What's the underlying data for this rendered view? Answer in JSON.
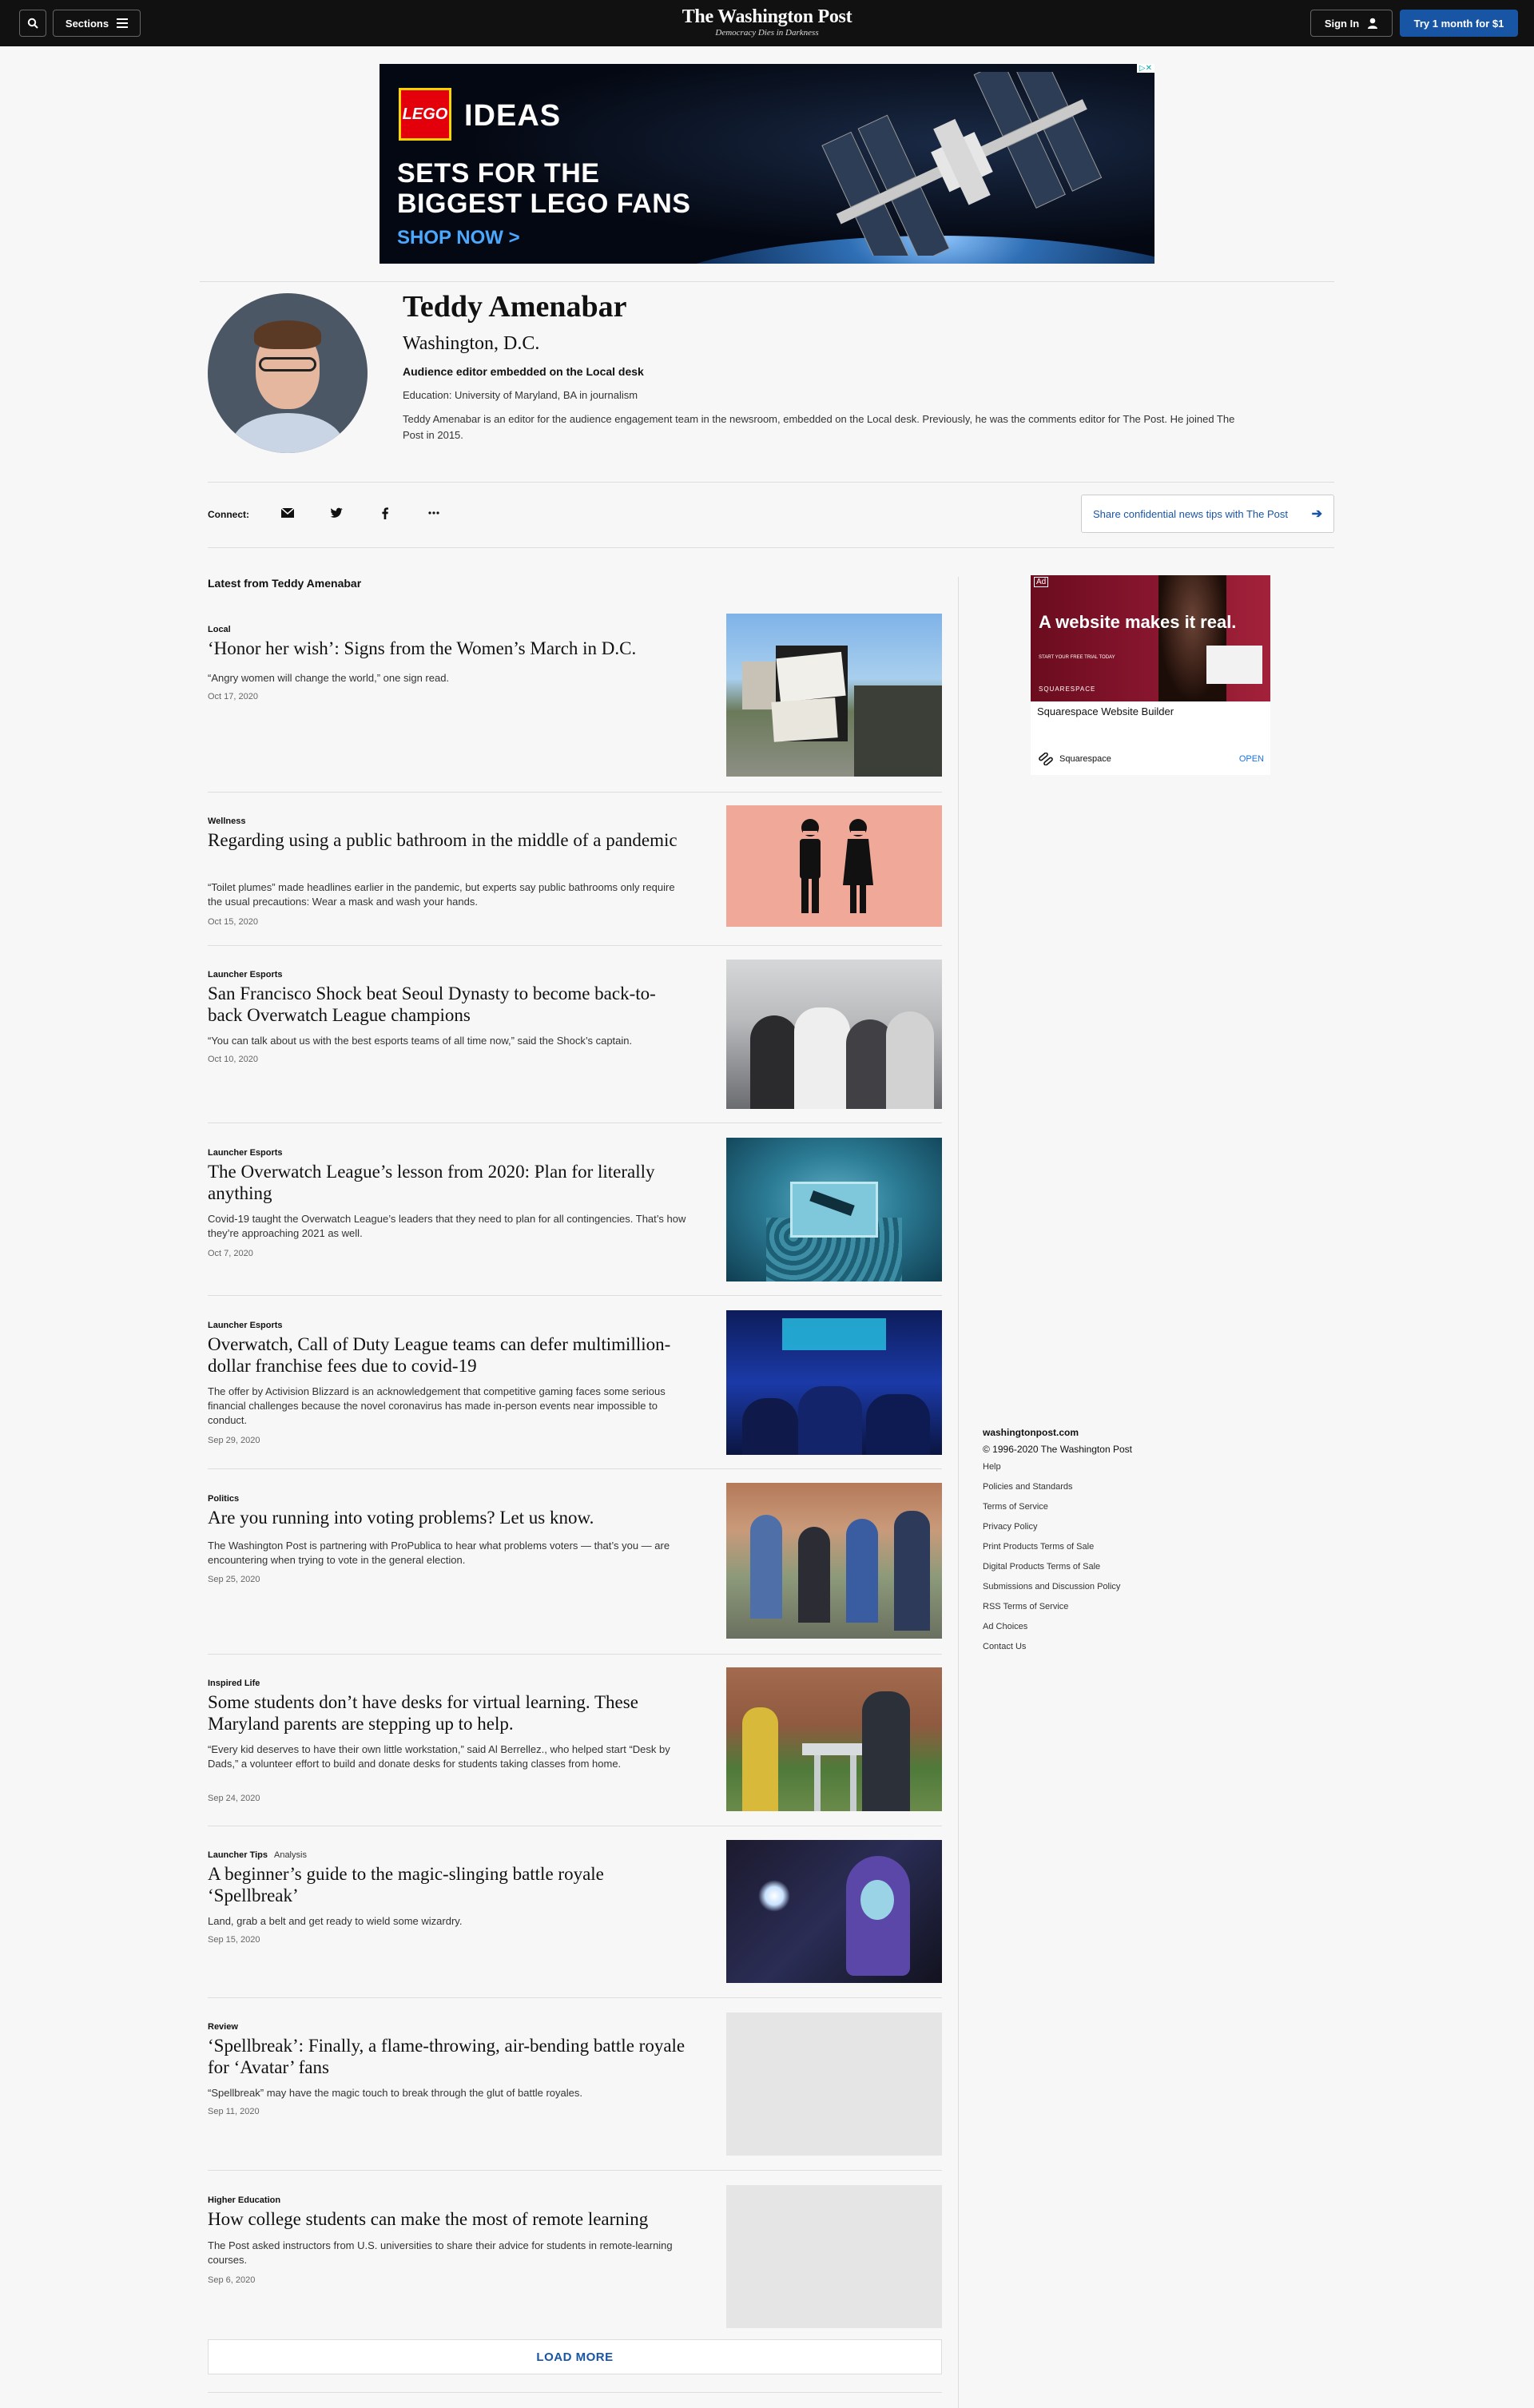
{
  "topbar": {
    "sections_label": "Sections",
    "logo_name": "The Washington Post",
    "logo_tagline": "Democracy Dies in Darkness",
    "signin_label": "Sign In",
    "trial_label": "Try 1 month for $1"
  },
  "top_ad": {
    "brand": "LEGO",
    "product": "IDEAS",
    "line1": "SETS FOR THE",
    "line2": "BIGGEST LEGO FANS",
    "cta": "SHOP NOW >"
  },
  "profile": {
    "name": "Teddy Amenabar",
    "location": "Washington, D.C.",
    "role": "Audience editor embedded on the Local desk",
    "education": "Education: University of Maryland, BA in journalism",
    "bio": "Teddy Amenabar is an editor for the audience engagement team in the newsroom, embedded on the Local desk. Previously, he was the comments editor for The Post. He joined The Post in 2015."
  },
  "connect": {
    "label": "Connect:",
    "share_label": "Share confidential news tips with The Post"
  },
  "latest_label": "Latest from Teddy Amenabar",
  "articles": [
    {
      "kicker": "Local",
      "headline": "‘Honor her wish’: Signs from the Women’s March in D.C.",
      "blurb": "“Angry women will change the world,” one sign read.",
      "date": "Oct 17, 2020"
    },
    {
      "kicker": "Wellness",
      "headline": "Regarding using a public bathroom in the middle of a pandemic",
      "blurb": "“Toilet plumes” made headlines earlier in the pandemic, but experts say public bathrooms only require the usual precautions: Wear a mask and wash your hands.",
      "date": "Oct 15, 2020"
    },
    {
      "kicker": "Launcher Esports",
      "headline": "San Francisco Shock beat Seoul Dynasty to become back-to-back Overwatch League champions",
      "blurb": "“You can talk about us with the best esports teams of all time now,” said the Shock’s captain.",
      "date": "Oct 10, 2020"
    },
    {
      "kicker": "Launcher Esports",
      "headline": "The Overwatch League’s lesson from 2020: Plan for literally anything",
      "blurb": "Covid-19 taught the Overwatch League’s leaders that they need to plan for all contingencies. That’s how they’re approaching 2021 as well.",
      "date": "Oct 7, 2020"
    },
    {
      "kicker": "Launcher Esports",
      "headline": "Overwatch, Call of Duty League teams can defer multimillion-dollar franchise fees due to covid-19",
      "blurb": "The offer by Activision Blizzard is an acknowledgement that competitive gaming faces some serious financial challenges because the novel coronavirus has made in-person events near impossible to conduct.",
      "date": "Sep 29, 2020"
    },
    {
      "kicker": "Politics",
      "headline": "Are you running into voting problems? Let us know.",
      "blurb": "The Washington Post is partnering with ProPublica to hear what problems voters — that’s you — are encountering when trying to vote in the general election.",
      "date": "Sep 25, 2020"
    },
    {
      "kicker": "Inspired Life",
      "headline": "Some students don’t have desks for virtual learning. These Maryland parents are stepping up to help.",
      "blurb": "“Every kid deserves to have their own little workstation,” said Al Berrellez., who helped start “Desk by Dads,” a volunteer effort to build and donate desks for students taking classes from home.",
      "date": "Sep 24, 2020"
    },
    {
      "kicker": "Launcher Tips",
      "kicker_sub": "Analysis",
      "headline": "A beginner’s guide to the magic-slinging battle royale ‘Spellbreak’",
      "blurb": "Land, grab a belt and get ready to wield some wizardry.",
      "date": "Sep 15, 2020"
    },
    {
      "kicker": "Review",
      "headline": "‘Spellbreak’: Finally, a flame-throwing, air-bending battle royale for ‘Avatar’ fans",
      "blurb": "“Spellbreak” may have the magic touch to break through the glut of battle royales.",
      "date": "Sep 11, 2020"
    },
    {
      "kicker": "Higher Education",
      "headline": "How college students can make the most of remote learning",
      "blurb": "The Post asked instructors from U.S. universities to share their advice for students in remote-learning courses.",
      "date": "Sep 6, 2020"
    }
  ],
  "load_more": "LOAD MORE",
  "side_ad": {
    "tag": "Ad",
    "headline": "A website makes it real.",
    "sub": "START YOUR FREE TRIAL TODAY",
    "brand_small": "SQUARESPACE",
    "title": "Squarespace Website Builder",
    "brand": "Squarespace",
    "open": "OPEN"
  },
  "footer": {
    "site": "washingtonpost.com",
    "copyright": "© 1996-2020 The Washington Post",
    "links": [
      "Help",
      "Policies and Standards",
      "Terms of Service",
      "Privacy Policy",
      "Print Products Terms of Sale",
      "Digital Products Terms of Sale",
      "Submissions and Discussion Policy",
      "RSS Terms of Service",
      "Ad Choices",
      "Contact Us"
    ]
  },
  "colors": {
    "accent": "#1955a5",
    "topbar": "#111111"
  }
}
